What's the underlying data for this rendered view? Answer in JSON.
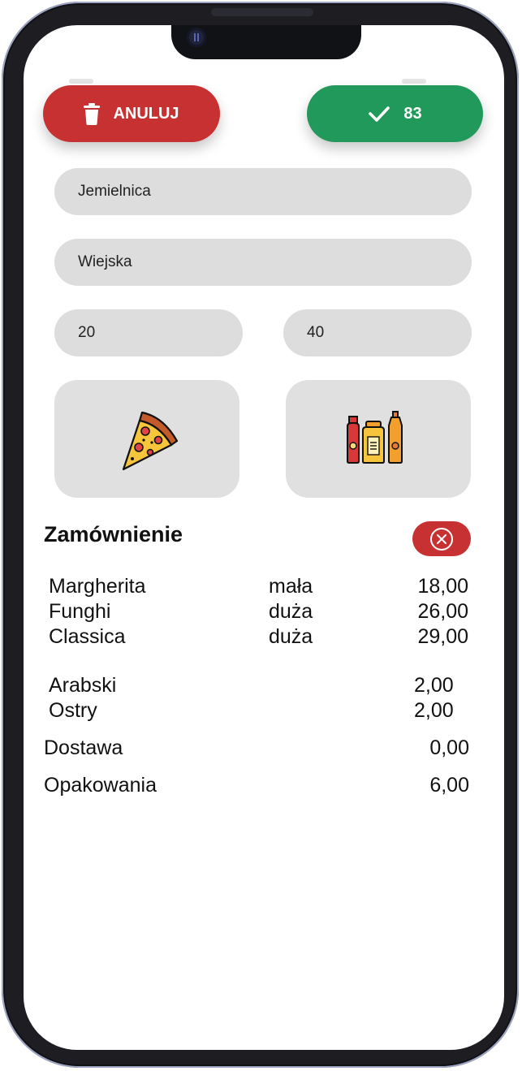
{
  "toolbar": {
    "cancel_label": "ANULUJ",
    "confirm_label": "83"
  },
  "form": {
    "city": "Jemielnica",
    "street": "Wiejska",
    "house_number": "20",
    "apartment_number": "40"
  },
  "categories": [
    {
      "icon": "pizza-slice-icon"
    },
    {
      "icon": "sauce-bottles-icon"
    }
  ],
  "order": {
    "title": "Zamównienie",
    "pizzas": [
      {
        "name": "Margherita",
        "size": "mała",
        "price": "18,00"
      },
      {
        "name": "Funghi",
        "size": "duża",
        "price": "26,00"
      },
      {
        "name": "Classica",
        "size": "duża",
        "price": "29,00"
      }
    ],
    "sauces": [
      {
        "name": "Arabski",
        "price": "2,00"
      },
      {
        "name": "Ostry",
        "price": "2,00"
      }
    ],
    "delivery": {
      "label": "Dostawa",
      "price": "0,00"
    },
    "packaging": {
      "label": "Opakowania",
      "price": "6,00"
    }
  },
  "colors": {
    "cancel": "#c83131",
    "confirm": "#21995a",
    "field_bg": "#dddddd"
  }
}
